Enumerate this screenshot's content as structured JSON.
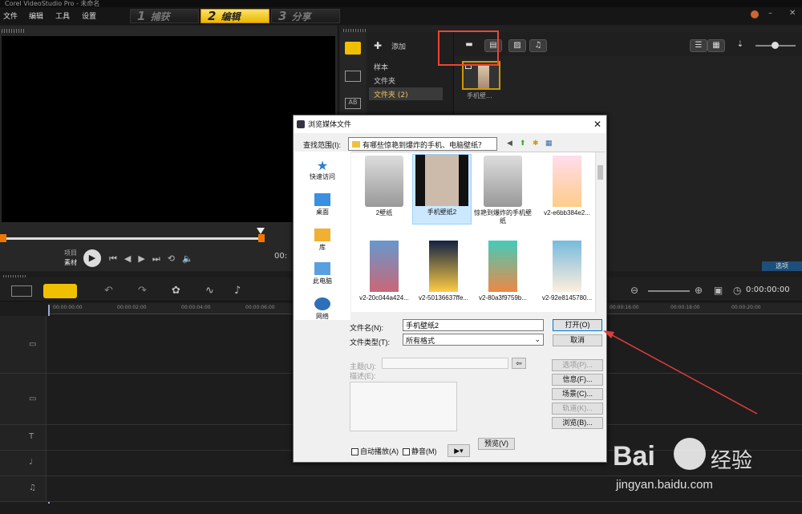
{
  "app": {
    "title": "Corel VideoStudio Pro - 未命名"
  },
  "menu": [
    "文件",
    "编辑",
    "工具",
    "设置"
  ],
  "steps": [
    {
      "num": "1",
      "label": "捕获"
    },
    {
      "num": "2",
      "label": "编辑"
    },
    {
      "num": "3",
      "label": "分享"
    }
  ],
  "preview": {
    "mode_project": "项目",
    "mode_clip": "素材",
    "timecode_prefix": "00:"
  },
  "library": {
    "add_label": "添加",
    "tree": [
      "样本",
      "文件夹",
      "文件夹 (2)"
    ],
    "thumb_label": "手机壁...",
    "options_label": "选项"
  },
  "timeline": {
    "timecode": "0:00:00:00",
    "ruler": [
      "00:00:00:00",
      "00:00:02:00",
      "00:00:04:00",
      "00:00:06:00",
      "00:00:16:00",
      "00:00:18:00",
      "00:00:20:00"
    ]
  },
  "dialog": {
    "title": "浏览媒体文件",
    "lookin_label": "查找范围(I):",
    "lookin_value": "有哪些惊艳到爆炸的手机、电脑壁纸？",
    "places": [
      "快速访问",
      "桌面",
      "库",
      "此电脑",
      "网络"
    ],
    "files": [
      "2壁纸",
      "手机壁纸2",
      "惊艳到爆炸的手机壁纸",
      "v2-e6bb384e2...",
      "v2-20c044a424...",
      "v2-50136637ffe...",
      "v2-80a3f9759b...",
      "v2-92e8145780..."
    ],
    "filename_label": "文件名(N):",
    "filename_value": "手机壁纸2",
    "filetype_label": "文件类型(T):",
    "filetype_value": "所有格式",
    "open_label": "打开(O)",
    "cancel_label": "取消",
    "subject_label": "主题(U):",
    "desc_label": "描述(E):",
    "options_label": "选项(P)...",
    "info_label": "信息(F)...",
    "scene_label": "场景(C)...",
    "track_label": "轨道(K)...",
    "browse_label": "浏览(B)...",
    "autoplay_label": "自动播放(A)",
    "mute_label": "静音(M)",
    "preview_label": "预览(V)"
  },
  "watermark": {
    "brand": "Bai",
    "brand2": "经验",
    "url": "jingyan.baidu.com"
  },
  "colors": {
    "accent": "#f0c000",
    "annotation": "#e43b3b",
    "selection": "#cce8ff"
  }
}
